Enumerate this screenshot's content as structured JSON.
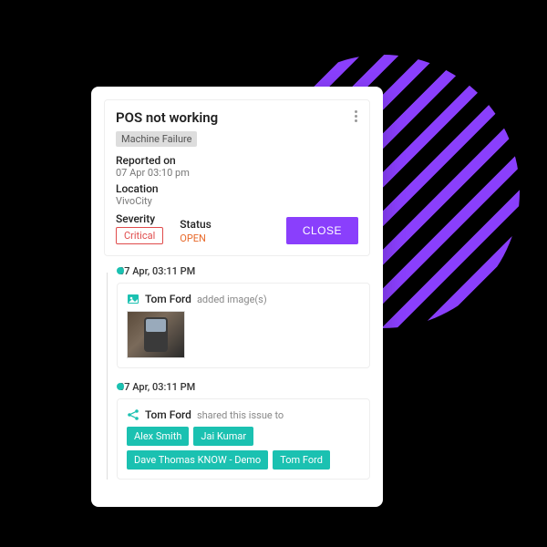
{
  "issue": {
    "title": "POS not working",
    "category": "Machine Failure",
    "reported_label": "Reported on",
    "reported_value": "07 Apr 03:10 pm",
    "location_label": "Location",
    "location_value": "VivoCity",
    "severity_label": "Severity",
    "severity_value": "Critical",
    "status_label": "Status",
    "status_value": "OPEN",
    "close_label": "CLOSE"
  },
  "timeline": [
    {
      "time": "07 Apr, 03:11 PM",
      "actor": "Tom Ford",
      "action": "added image(s)",
      "type": "image"
    },
    {
      "time": "07 Apr, 03:11 PM",
      "actor": "Tom Ford",
      "action": "shared this issue to",
      "type": "share",
      "recipients": [
        "Alex Smith",
        "Jai Kumar",
        "Dave Thomas KNOW - Demo",
        "Tom Ford"
      ]
    }
  ]
}
